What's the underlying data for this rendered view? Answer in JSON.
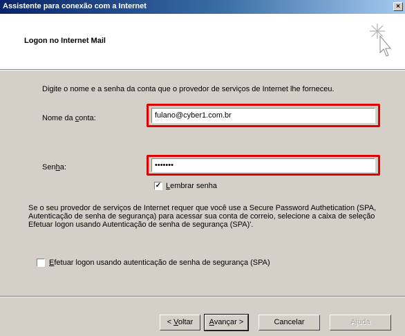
{
  "window": {
    "title": "Assistente para conexão com a Internet",
    "close_glyph": "×"
  },
  "header": {
    "title": "Logon no Internet Mail",
    "graphic_icon": "sparkle-cursor-icon"
  },
  "intro_text": "Digite o nome e a senha da conta que o provedor de serviços de Internet lhe forneceu.",
  "account": {
    "label_pre": "Nome da ",
    "label_u": "c",
    "label_post": "onta:",
    "value": "fulano@cyber1.com.br"
  },
  "password": {
    "label_pre": "Sen",
    "label_u": "h",
    "label_post": "a:",
    "value": "•••••••"
  },
  "remember": {
    "checked_glyph": "✓",
    "label_u": "L",
    "label_post": "embrar senha"
  },
  "spa_paragraph": "Se o seu provedor de serviços de Internet requer que você use a Secure Password Authetication (SPA, Autenticação de senha de segurança) para acessar sua conta de correio, selecione a caixa de seleção Efetuar logon usando Autenticação de senha de segurança (SPA)'.",
  "spa_checkbox": {
    "label_u": "E",
    "label_post": "fetuar logon usando autenticação de senha de segurança (SPA)"
  },
  "buttons": {
    "back_pre": "< ",
    "back_u": "V",
    "back_post": "oltar",
    "next_u": "A",
    "next_post": "vançar >",
    "cancel": "Cancelar",
    "help": "Ajuda"
  },
  "colors": {
    "highlight": "#e00000",
    "titlebar_start": "#0a246a",
    "dialog_bg": "#d4d0c8"
  }
}
